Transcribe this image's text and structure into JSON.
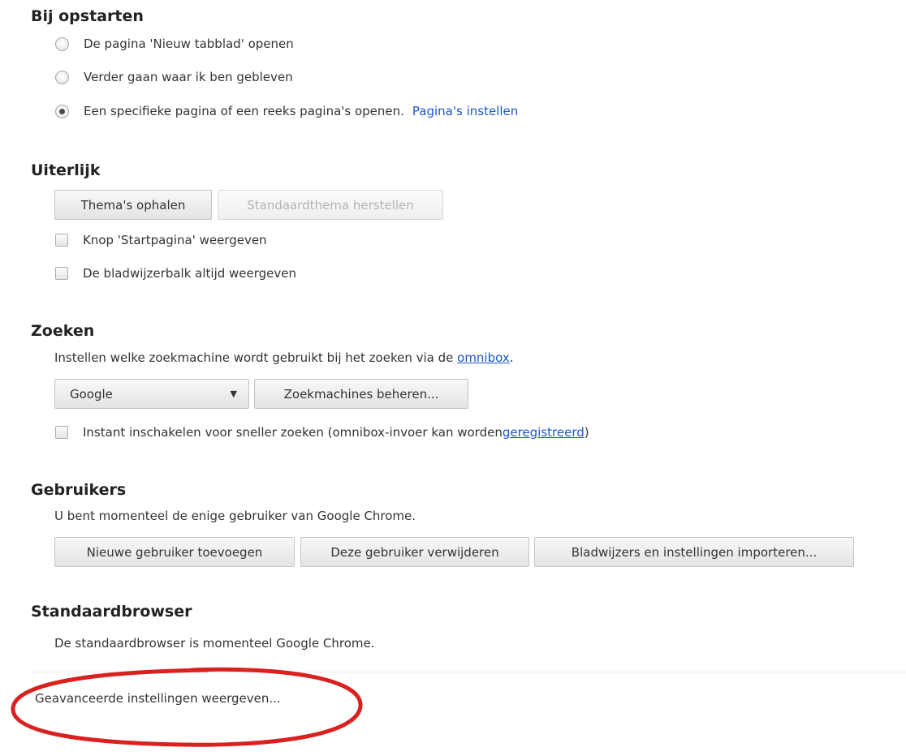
{
  "startup": {
    "title": "Bij opstarten",
    "options": [
      {
        "label": "De pagina 'Nieuw tabblad' openen",
        "selected": false
      },
      {
        "label": "Verder gaan waar ik ben gebleven",
        "selected": false
      },
      {
        "label": "Een specifieke pagina of een reeks pagina's openen.",
        "selected": true
      }
    ],
    "set_pages_link": "Pagina's instellen"
  },
  "appearance": {
    "title": "Uiterlijk",
    "get_themes_button": "Thema's ophalen",
    "reset_theme_button": "Standaardthema herstellen",
    "show_home_button_label": "Knop 'Startpagina' weergeven",
    "show_bookmarks_bar_label": "De bladwijzerbalk altijd weergeven"
  },
  "search": {
    "title": "Zoeken",
    "description": "Instellen welke zoekmachine wordt gebruikt bij het zoeken via de ",
    "omnibox_link": "omnibox",
    "description_end": ".",
    "engine_selected": "Google",
    "manage_button": "Zoekmachines beheren...",
    "instant_label": "Instant inschakelen voor sneller zoeken (omnibox-invoer kan worden ",
    "instant_link": "geregistreerd",
    "instant_end": ")"
  },
  "users": {
    "title": "Gebruikers",
    "description": "U bent momenteel de enige gebruiker van Google Chrome.",
    "add_button": "Nieuwe gebruiker toevoegen",
    "remove_button": "Deze gebruiker verwijderen",
    "import_button": "Bladwijzers en instellingen importeren..."
  },
  "default_browser": {
    "title": "Standaardbrowser",
    "description": "De standaardbrowser is momenteel Google Chrome."
  },
  "advanced_link": "Geavanceerde instellingen weergeven...",
  "colors": {
    "link": "#1a56c9",
    "annotation_circle": "#d9211f"
  }
}
